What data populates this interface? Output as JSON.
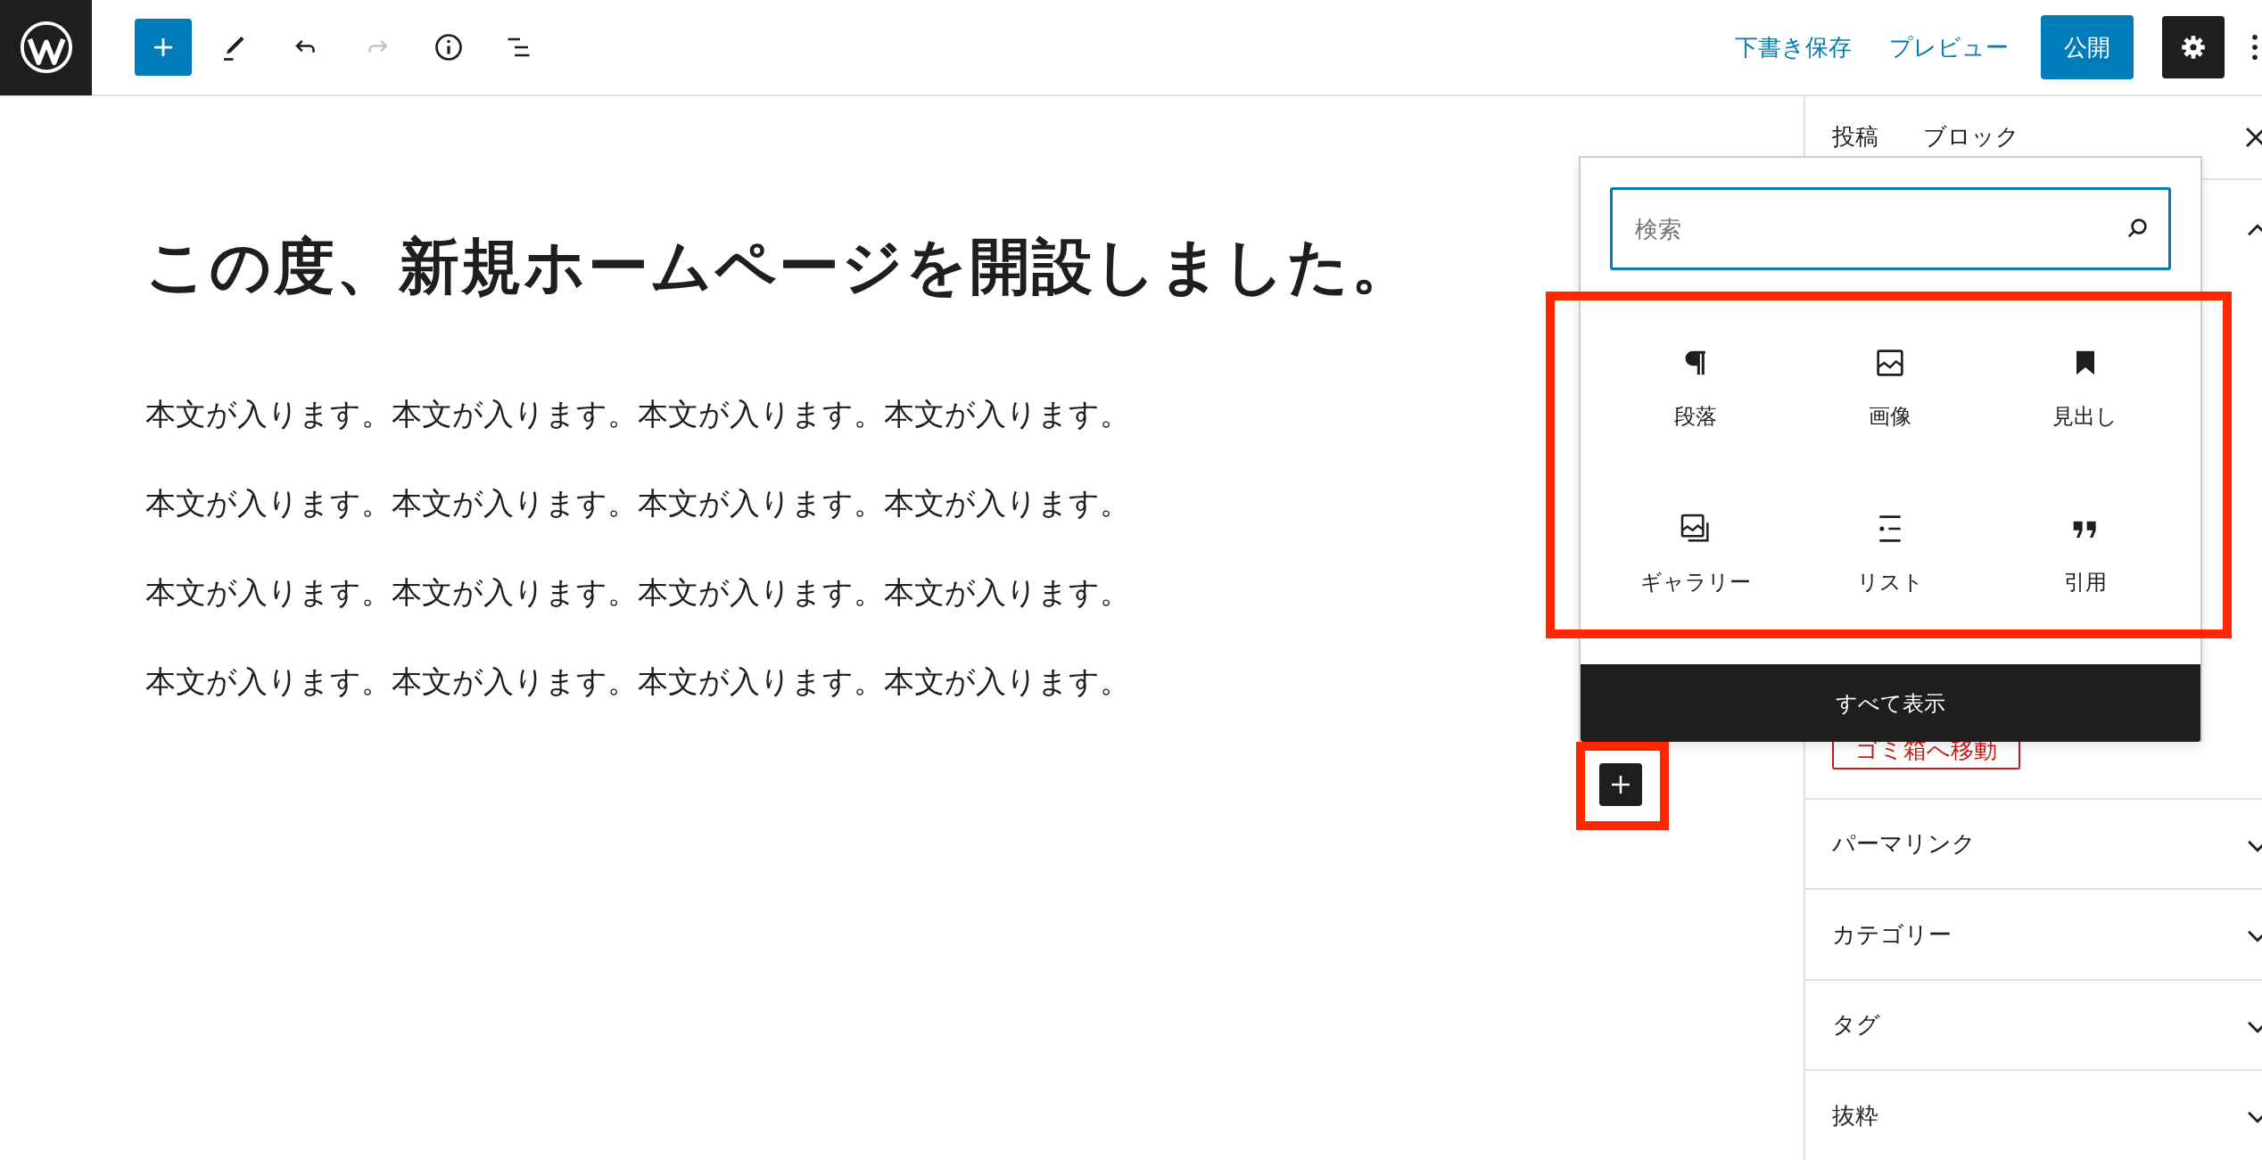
{
  "toolbar": {
    "tools": [
      {
        "kind": "inserter",
        "disabled": false
      },
      {
        "kind": "edit",
        "disabled": false
      },
      {
        "kind": "undo",
        "disabled": false
      },
      {
        "kind": "redo",
        "disabled": true
      },
      {
        "kind": "details",
        "disabled": false
      },
      {
        "kind": "list-view",
        "disabled": false
      }
    ],
    "save_draft": "下書き保存",
    "preview": "プレビュー",
    "publish": "公開",
    "settings_active": true
  },
  "document": {
    "title": "この度、新規ホームページを開設しました。",
    "paragraphs": [
      "本文が入ります。本文が入ります。本文が入ります。本文が入ります。",
      "本文が入ります。本文が入ります。本文が入ります。本文が入ります。",
      "本文が入ります。本文が入ります。本文が入ります。本文が入ります。",
      "本文が入ります。本文が入ります。本文が入ります。本文が入ります。"
    ]
  },
  "sidebar": {
    "tabs": [
      "投稿",
      "ブロック"
    ],
    "panel_expanded": true,
    "trash_button": "ゴミ箱へ移動",
    "sections": [
      {
        "label": "パーマリンク",
        "expanded": false
      },
      {
        "label": "カテゴリー",
        "expanded": false
      },
      {
        "label": "タグ",
        "expanded": false
      },
      {
        "label": "抜粋",
        "expanded": false
      }
    ]
  },
  "inserter_popover": {
    "search": {
      "placeholder": "検索"
    },
    "highlighted": true,
    "blocks": [
      {
        "kind": "paragraph",
        "label": "段落"
      },
      {
        "kind": "image",
        "label": "画像"
      },
      {
        "kind": "heading",
        "label": "見出し"
      },
      {
        "kind": "gallery",
        "label": "ギャラリー"
      },
      {
        "kind": "list",
        "label": "リスト"
      },
      {
        "kind": "quote",
        "label": "引用"
      }
    ],
    "browse_all": "すべて表示"
  },
  "inserter_button": {
    "highlighted": true
  }
}
